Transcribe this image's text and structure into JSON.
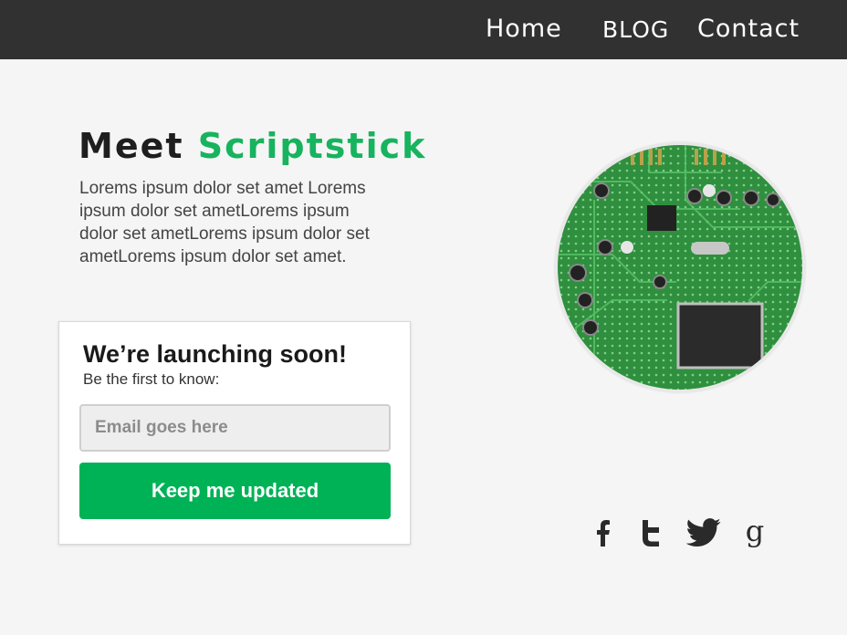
{
  "nav": {
    "links": [
      {
        "label": "Home"
      },
      {
        "label": "Blog"
      },
      {
        "label": "Contact"
      }
    ]
  },
  "hero": {
    "title_prefix": "Meet",
    "title_brand": "Scriptstick",
    "description": "Lorems ipsum dolor set amet Lorems ipsum dolor set ametLorems ipsum dolor set ametLorems ipsum dolor set ametLorems ipsum dolor set amet."
  },
  "signup": {
    "heading": "We’re launching soon!",
    "subheading": "Be the first to know:",
    "email_placeholder": "Email goes here",
    "email_value": "",
    "button_label": "Keep me updated"
  },
  "social": {
    "icons": [
      "facebook-icon",
      "tumblr-icon",
      "twitter-icon",
      "google-icon"
    ],
    "google_glyph": "g"
  },
  "colors": {
    "accent": "#17b35e",
    "button": "#00b256",
    "navbar": "#313131",
    "page_background": "#f5f5f5"
  }
}
